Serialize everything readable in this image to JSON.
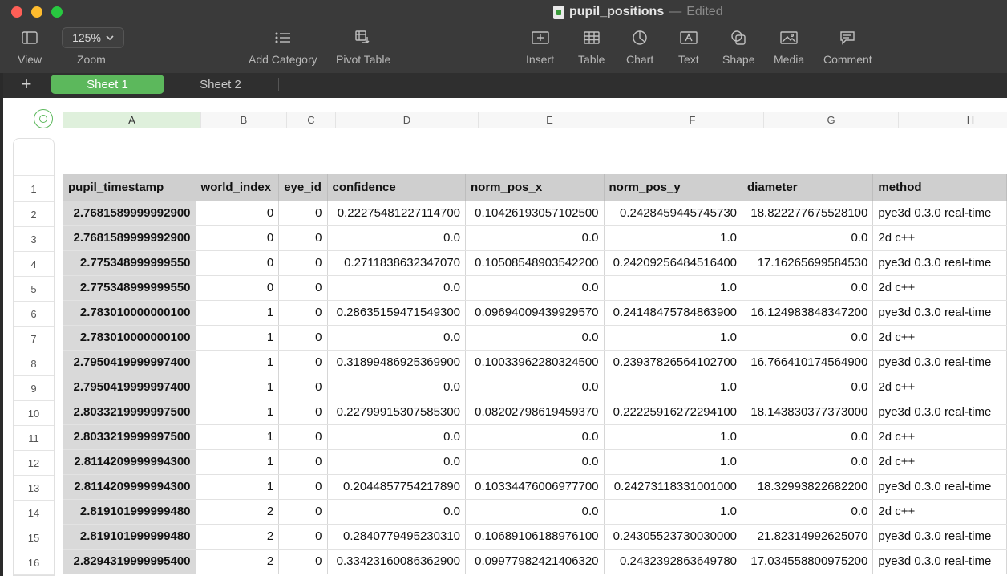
{
  "window": {
    "title": "pupil_positions",
    "separator": "—",
    "status": "Edited"
  },
  "toolbar": {
    "view_label": "View",
    "zoom_value": "125%",
    "zoom_label": "Zoom",
    "add_category_label": "Add Category",
    "pivot_table_label": "Pivot Table",
    "insert_label": "Insert",
    "table_label": "Table",
    "chart_label": "Chart",
    "text_label": "Text",
    "shape_label": "Shape",
    "media_label": "Media",
    "comment_label": "Comment"
  },
  "sheets": {
    "add_icon": "+",
    "tabs": [
      "Sheet 1",
      "Sheet 2"
    ],
    "active": "Sheet 1"
  },
  "columns": [
    "A",
    "B",
    "C",
    "D",
    "E",
    "F",
    "G",
    "H"
  ],
  "rows": [
    "1",
    "2",
    "3",
    "4",
    "5",
    "6",
    "7",
    "8",
    "9",
    "10",
    "11",
    "12",
    "13",
    "14",
    "15",
    "16"
  ],
  "table": {
    "headers": [
      "pupil_timestamp",
      "world_index",
      "eye_id",
      "confidence",
      "norm_pos_x",
      "norm_pos_y",
      "diameter",
      "method"
    ],
    "rows": [
      [
        "2.7681589999992900",
        "0",
        "0",
        "0.22275481227114700",
        "0.10426193057102500",
        "0.2428459445745730",
        "18.822277675528100",
        "pye3d 0.3.0 real-time"
      ],
      [
        "2.7681589999992900",
        "0",
        "0",
        "0.0",
        "0.0",
        "1.0",
        "0.0",
        "2d c++"
      ],
      [
        "2.775348999999550",
        "0",
        "0",
        "0.2711838632347070",
        "0.10508548903542200",
        "0.24209256484516400",
        "17.16265699584530",
        "pye3d 0.3.0 real-time"
      ],
      [
        "2.775348999999550",
        "0",
        "0",
        "0.0",
        "0.0",
        "1.0",
        "0.0",
        "2d c++"
      ],
      [
        "2.783010000000100",
        "1",
        "0",
        "0.28635159471549300",
        "0.09694009439929570",
        "0.24148475784863900",
        "16.124983848347200",
        "pye3d 0.3.0 real-time"
      ],
      [
        "2.783010000000100",
        "1",
        "0",
        "0.0",
        "0.0",
        "1.0",
        "0.0",
        "2d c++"
      ],
      [
        "2.7950419999997400",
        "1",
        "0",
        "0.31899486925369900",
        "0.10033962280324500",
        "0.23937826564102700",
        "16.766410174564900",
        "pye3d 0.3.0 real-time"
      ],
      [
        "2.7950419999997400",
        "1",
        "0",
        "0.0",
        "0.0",
        "1.0",
        "0.0",
        "2d c++"
      ],
      [
        "2.8033219999997500",
        "1",
        "0",
        "0.22799915307585300",
        "0.08202798619459370",
        "0.22225916272294100",
        "18.143830377373000",
        "pye3d 0.3.0 real-time"
      ],
      [
        "2.8033219999997500",
        "1",
        "0",
        "0.0",
        "0.0",
        "1.0",
        "0.0",
        "2d c++"
      ],
      [
        "2.8114209999994300",
        "1",
        "0",
        "0.0",
        "0.0",
        "1.0",
        "0.0",
        "2d c++"
      ],
      [
        "2.8114209999994300",
        "1",
        "0",
        "0.2044857754217890",
        "0.10334476006977700",
        "0.24273118331001000",
        "18.32993822682200",
        "pye3d 0.3.0 real-time"
      ],
      [
        "2.819101999999480",
        "2",
        "0",
        "0.0",
        "0.0",
        "1.0",
        "0.0",
        "2d c++"
      ],
      [
        "2.819101999999480",
        "2",
        "0",
        "0.2840779495230310",
        "0.10689106188976100",
        "0.24305523730030000",
        "21.82314992625070",
        "pye3d 0.3.0 real-time"
      ],
      [
        "2.8294319999995400",
        "2",
        "0",
        "0.33423160086362900",
        "0.09977982421406320",
        "0.2432392863649780",
        "17.034558800975200",
        "pye3d 0.3.0 real-time"
      ]
    ]
  }
}
